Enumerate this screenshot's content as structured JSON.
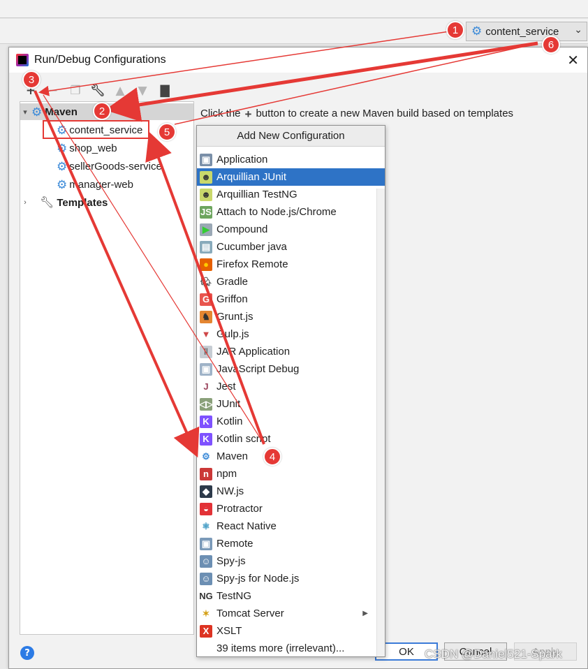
{
  "run_config": {
    "label": "content_service"
  },
  "dialog": {
    "title": "Run/Debug Configurations",
    "hint_prefix": "Click the",
    "hint_suffix": "button to create a new Maven build based on templates"
  },
  "tree": {
    "group": "Maven",
    "items": [
      "content_service",
      "shop_web",
      "sellerGoods-service",
      "manager-web"
    ],
    "templates": "Templates"
  },
  "popup": {
    "title": "Add New Configuration",
    "items": [
      {
        "label": "Application",
        "icon": "application-icon"
      },
      {
        "label": "Arquillian JUnit",
        "icon": "arquillian-icon"
      },
      {
        "label": "Arquillian TestNG",
        "icon": "arquillian-icon"
      },
      {
        "label": "Attach to Node.js/Chrome",
        "icon": "nodejs-icon"
      },
      {
        "label": "Compound",
        "icon": "compound-icon"
      },
      {
        "label": "Cucumber java",
        "icon": "cucumber-icon"
      },
      {
        "label": "Firefox Remote",
        "icon": "firefox-icon"
      },
      {
        "label": "Gradle",
        "icon": "gradle-icon"
      },
      {
        "label": "Griffon",
        "icon": "griffon-icon"
      },
      {
        "label": "Grunt.js",
        "icon": "grunt-icon"
      },
      {
        "label": "Gulp.js",
        "icon": "gulp-icon"
      },
      {
        "label": "JAR Application",
        "icon": "jar-icon"
      },
      {
        "label": "JavaScript Debug",
        "icon": "js-debug-icon"
      },
      {
        "label": "Jest",
        "icon": "jest-icon"
      },
      {
        "label": "JUnit",
        "icon": "junit-icon"
      },
      {
        "label": "Kotlin",
        "icon": "kotlin-icon"
      },
      {
        "label": "Kotlin script",
        "icon": "kotlin-icon"
      },
      {
        "label": "Maven",
        "icon": "maven-gear-icon"
      },
      {
        "label": "npm",
        "icon": "npm-icon"
      },
      {
        "label": "NW.js",
        "icon": "nwjs-icon"
      },
      {
        "label": "Protractor",
        "icon": "protractor-icon"
      },
      {
        "label": "React Native",
        "icon": "react-icon"
      },
      {
        "label": "Remote",
        "icon": "remote-icon"
      },
      {
        "label": "Spy-js",
        "icon": "spy-icon"
      },
      {
        "label": "Spy-js for Node.js",
        "icon": "spy-icon"
      },
      {
        "label": "TestNG",
        "icon": "testng-icon"
      },
      {
        "label": "Tomcat Server",
        "icon": "tomcat-icon"
      },
      {
        "label": "XSLT",
        "icon": "xslt-icon"
      },
      {
        "label": "39 items more (irrelevant)...",
        "icon": ""
      }
    ]
  },
  "buttons": {
    "ok": "OK",
    "cancel": "Cancel",
    "apply": "Apply"
  },
  "annotations": [
    "1",
    "2",
    "3",
    "4",
    "5",
    "6"
  ],
  "watermark": "CSDN @Daniel521-Spark",
  "colors": {
    "annotation_red": "#e53935",
    "selection_blue": "#2e73c6",
    "maven_gear": "#3d8bd8"
  }
}
